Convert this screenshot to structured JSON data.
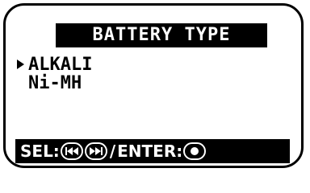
{
  "screen": {
    "title": "BATTERY TYPE",
    "menu": {
      "items": [
        {
          "label": "ALKALI",
          "selected": true
        },
        {
          "label": "Ni-MH",
          "selected": false
        }
      ]
    },
    "footer": {
      "sel_label": "SEL:",
      "separator": "/",
      "enter_label": "ENTER:",
      "icons": [
        "rewind-button-icon",
        "fast-forward-button-icon",
        "record-button-icon"
      ]
    }
  },
  "colors": {
    "background": "#ffffff",
    "foreground": "#000000",
    "inverse_text": "#ffffff"
  }
}
